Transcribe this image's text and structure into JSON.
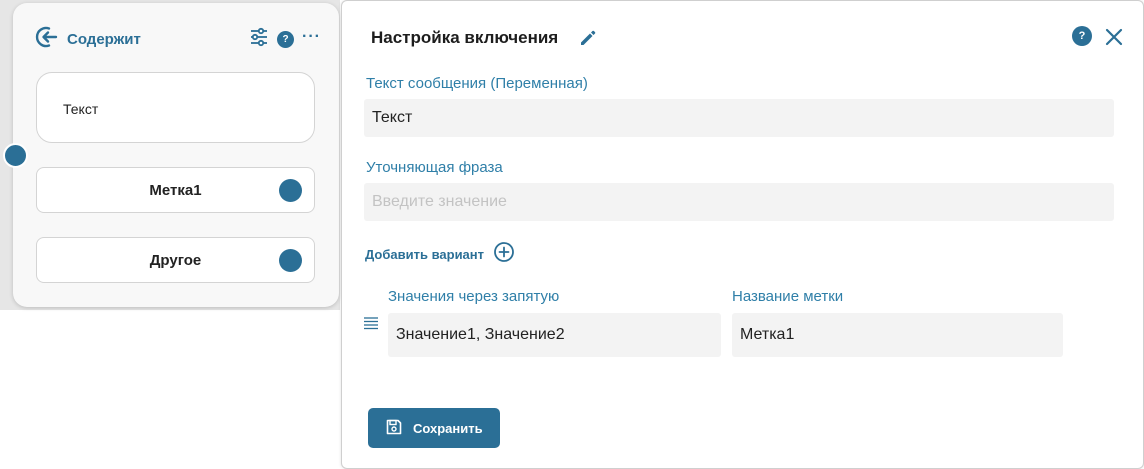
{
  "node": {
    "title": "Содержит",
    "text": "Текст",
    "labels": [
      {
        "label": "Метка1"
      },
      {
        "label": "Другое"
      }
    ]
  },
  "panel": {
    "title": "Настройка включения",
    "message_label": "Текст сообщения (Переменная)",
    "message_value": "Текст",
    "clarify_label": "Уточняющая фраза",
    "clarify_value": "",
    "clarify_placeholder": "Введите значение",
    "add_variant_label": "Добавить вариант",
    "variant": {
      "values_label": "Значения через запятую",
      "values_value": "Значение1, Значение2",
      "name_label": "Название метки",
      "name_value": "Метка1"
    },
    "save_label": "Сохранить"
  },
  "icons": {
    "node_entry": "enter-arrow-icon",
    "settings": "sliders-icon",
    "help": "question-icon",
    "more": "dots-icon",
    "edit": "pencil-icon",
    "close": "close-icon",
    "add": "plus-circle-icon",
    "drag": "drag-handle-icon",
    "save": "floppy-disk-icon"
  },
  "help_glyph": "?",
  "more_glyph": "···",
  "colors": {
    "accent": "#2b6f96",
    "label": "#2f7fa8",
    "input_bg": "#f3f3f3"
  }
}
